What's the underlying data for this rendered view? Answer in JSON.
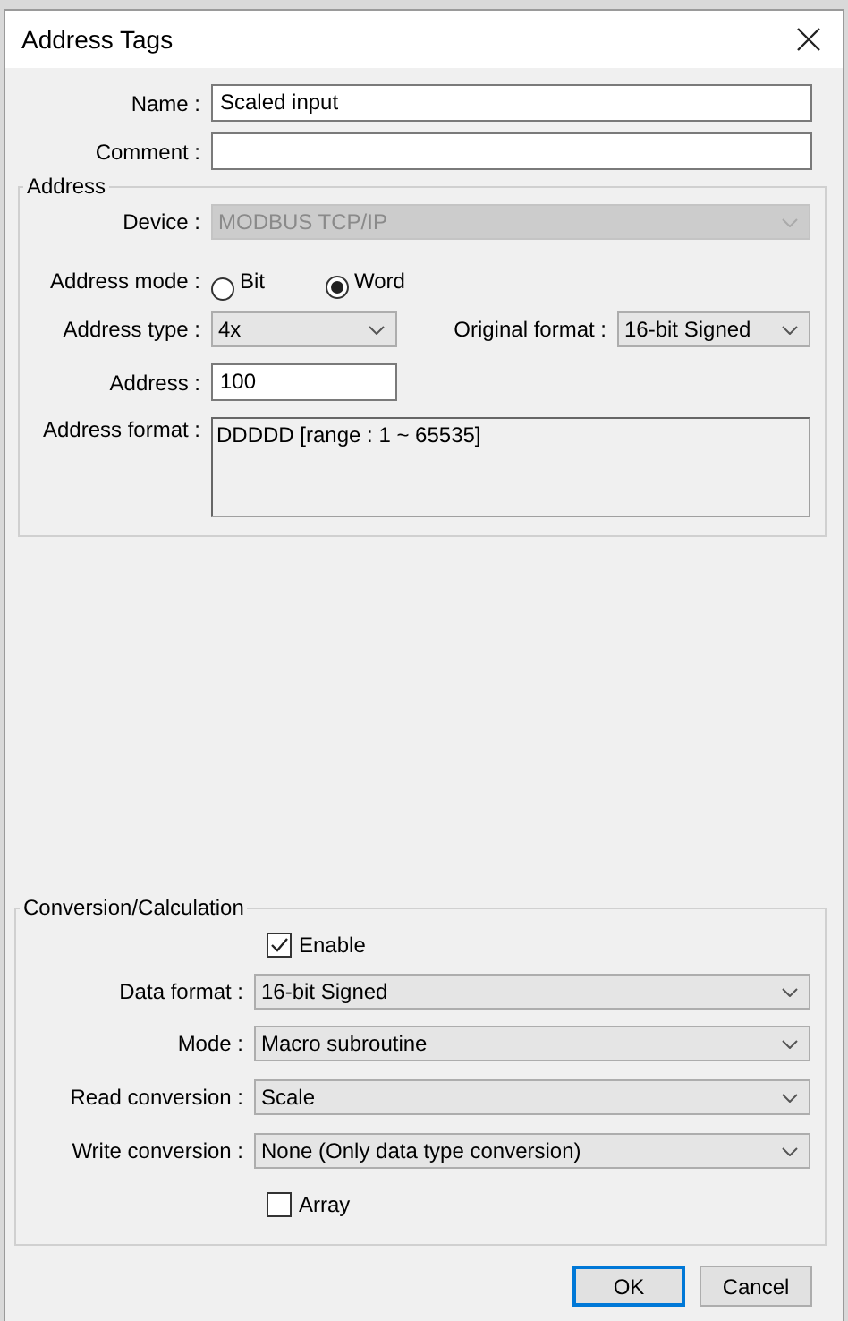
{
  "window": {
    "title": "Address Tags"
  },
  "fields": [
    {
      "label": "Name :",
      "value": "Scaled input"
    },
    {
      "label": "Comment :"
    }
  ],
  "address": {
    "title": "Address",
    "device": {
      "label": "Device :",
      "value": "MODBUS TCP/IP",
      "disabled": true
    },
    "address_mode": {
      "label": "Address mode :",
      "options": [
        {
          "label": "Bit",
          "selected": false
        },
        {
          "label": "Word",
          "selected": true
        }
      ]
    },
    "address_type": {
      "label": "Address type :",
      "value": "4x"
    },
    "original_format": {
      "label": "Original format :",
      "value": "16-bit Signed"
    },
    "address": {
      "label": "Address :",
      "value": "100"
    },
    "address_format": {
      "label": "Address format :",
      "value": "DDDDD [range : 1 ~ 65535]"
    }
  },
  "conversion": {
    "title": "Conversion/Calculation",
    "enable": {
      "label": "Enable",
      "checked": true
    },
    "rows": [
      {
        "label": "Data format :",
        "value": "16-bit Signed"
      },
      {
        "label": "Mode :",
        "value": "Macro subroutine"
      },
      {
        "label": "Read conversion :",
        "value": "Scale"
      },
      {
        "label": "Write conversion :",
        "value": "None (Only data type conversion)"
      }
    ],
    "array": {
      "label": "Array",
      "checked": false
    }
  },
  "buttons": [
    {
      "label": "OK",
      "default": true
    },
    {
      "label": "Cancel",
      "default": false
    }
  ]
}
